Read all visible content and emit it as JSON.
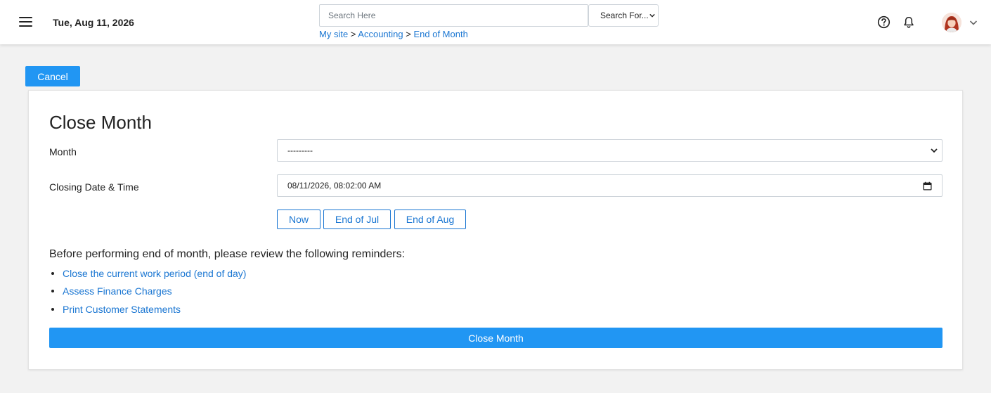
{
  "header": {
    "date": "Tue, Aug 11, 2026",
    "search_placeholder": "Search Here",
    "search_for": "Search For...",
    "breadcrumb": [
      {
        "label": "My site"
      },
      {
        "label": "Accounting"
      },
      {
        "label": "End of Month"
      }
    ],
    "breadcrumb_separator": ">",
    "icons": [
      "menu-icon",
      "help-icon",
      "bell-icon",
      "avatar",
      "chevron-down-icon"
    ]
  },
  "actions": {
    "cancel_label": "Cancel"
  },
  "form": {
    "title": "Close Month",
    "month_label": "Month",
    "month_value": "---------",
    "closing_label": "Closing Date & Time",
    "closing_value": "08/11/2026, 08:02:00 AM",
    "quick_buttons": [
      "Now",
      "End of Jul",
      "End of Aug"
    ],
    "reminder_heading": "Before performing end of month, please review the following reminders:",
    "reminders": [
      "Close the current work period (end of day)",
      "Assess Finance Charges",
      "Print Customer Statements"
    ],
    "submit_label": "Close Month"
  },
  "colors": {
    "primary": "#2196f3",
    "link": "#1a76d2",
    "background": "#f2f2f2"
  }
}
